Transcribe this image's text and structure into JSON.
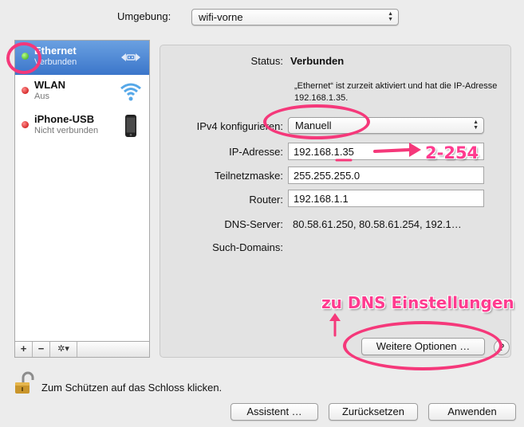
{
  "location": {
    "label": "Umgebung:",
    "value": "wifi-vorne"
  },
  "services": [
    {
      "name": "Ethernet",
      "status": "Verbunden",
      "state_color": "#2fa10d",
      "icon": "ethernet-arrows-icon"
    },
    {
      "name": "WLAN",
      "status": "Aus",
      "state_color": "#c40000",
      "icon": "wifi-icon"
    },
    {
      "name": "iPhone-USB",
      "status": "Nicht verbunden",
      "state_color": "#c40000",
      "icon": "iphone-icon"
    }
  ],
  "list_toolbar": {
    "add": "+",
    "remove": "−",
    "gear": "✲▾"
  },
  "detail": {
    "status_label": "Status:",
    "status_value": "Verbunden",
    "status_desc": "„Ethernet“ ist zurzeit aktiviert und hat die IP-Adresse 192.168.1.35.",
    "ipv4_label": "IPv4 konfigurieren:",
    "ipv4_value": "Manuell",
    "ip_label": "IP-Adresse:",
    "ip_value": "192.168.1.35",
    "subnet_label": "Teilnetzmaske:",
    "subnet_value": "255.255.255.0",
    "router_label": "Router:",
    "router_value": "192.168.1.1",
    "dns_label": "DNS-Server:",
    "dns_value": "80.58.61.250, 80.58.61.254, 192.1…",
    "search_label": "Such-Domains:",
    "search_value": ""
  },
  "more_options_label": "Weitere Optionen …",
  "help_label": "?",
  "lock_text": "Zum Schützen auf das Schloss klicken.",
  "bottom_buttons": {
    "assistant": "Assistent …",
    "revert": "Zurücksetzen",
    "apply": "Anwenden"
  },
  "annotations": {
    "ip_range": "2-254",
    "dns_hint": "zu DNS Einstellungen"
  },
  "colors": {
    "accent": "#3b76ca",
    "annotation": "#f5387a"
  }
}
